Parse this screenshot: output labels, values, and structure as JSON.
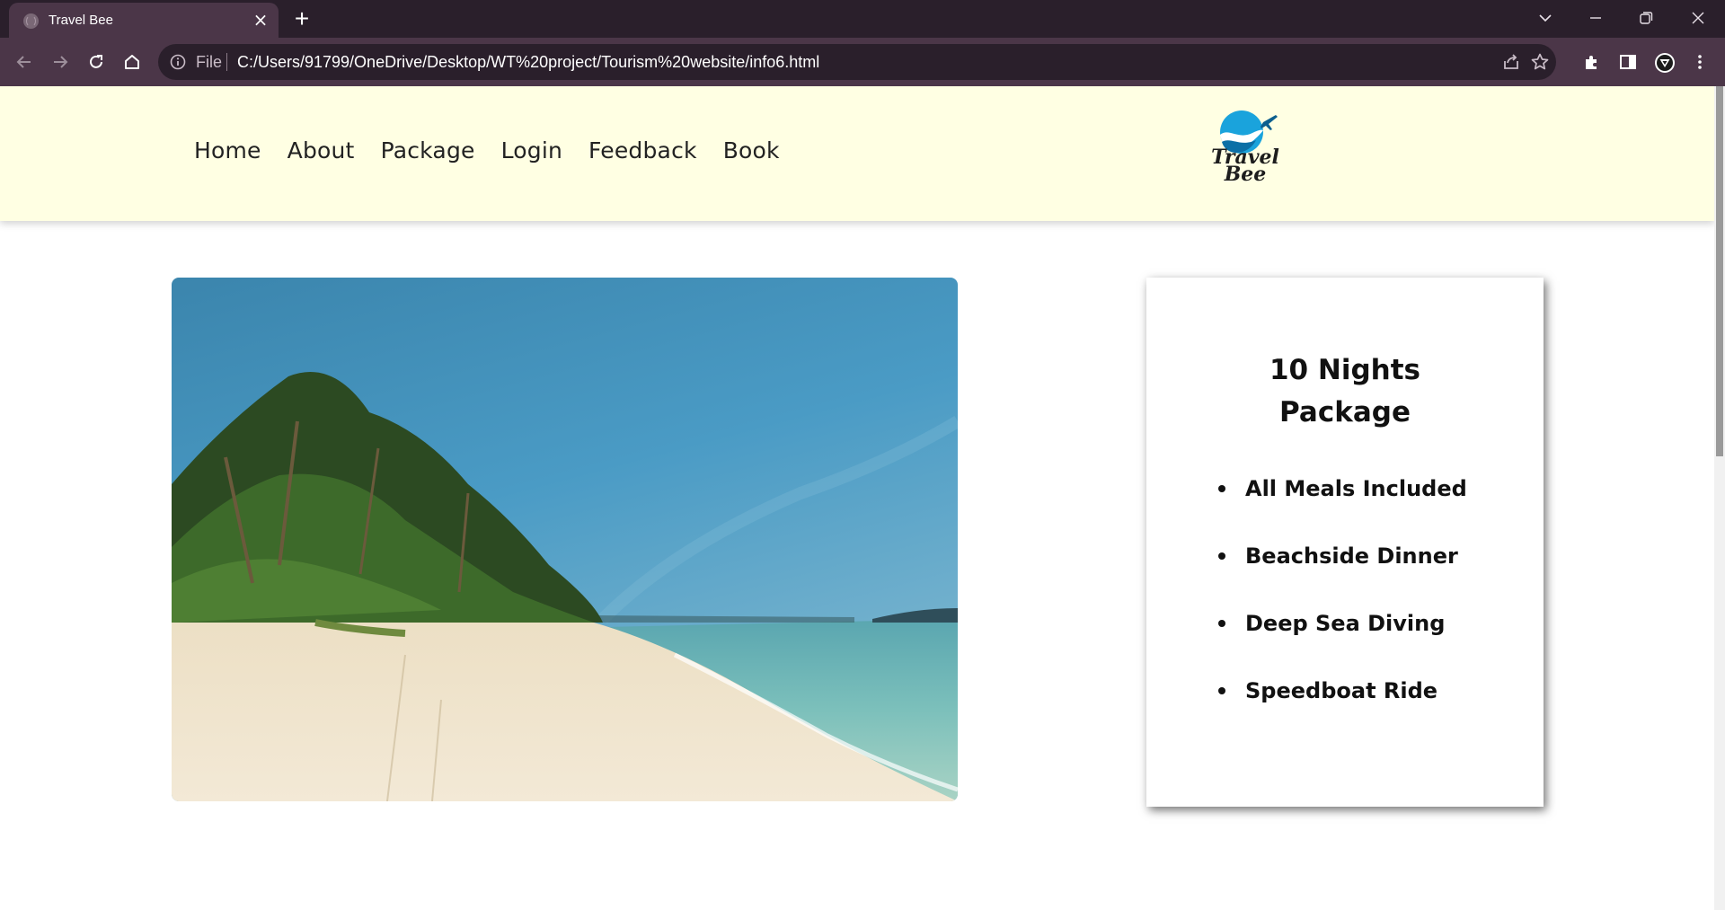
{
  "browser": {
    "tab_title": "Travel Bee",
    "file_label": "File",
    "url": "C:/Users/91799/OneDrive/Desktop/WT%20project/Tourism%20website/info6.html"
  },
  "site": {
    "nav": [
      "Home",
      "About",
      "Package",
      "Login",
      "Feedback",
      "Book"
    ],
    "logo": {
      "line1": "Travel",
      "line2": "Bee"
    }
  },
  "package_card": {
    "title_line1": "10 Nights",
    "title_line2": "Package",
    "features": [
      "All Meals Included",
      "Beachside Dinner",
      "Deep Sea Diving",
      "Speedboat Ride"
    ]
  },
  "colors": {
    "header_bg": "#ffffe3",
    "chrome_dark": "#2a1f2b",
    "chrome_mid": "#4b3648",
    "logo_blue": "#1aa3dc"
  }
}
